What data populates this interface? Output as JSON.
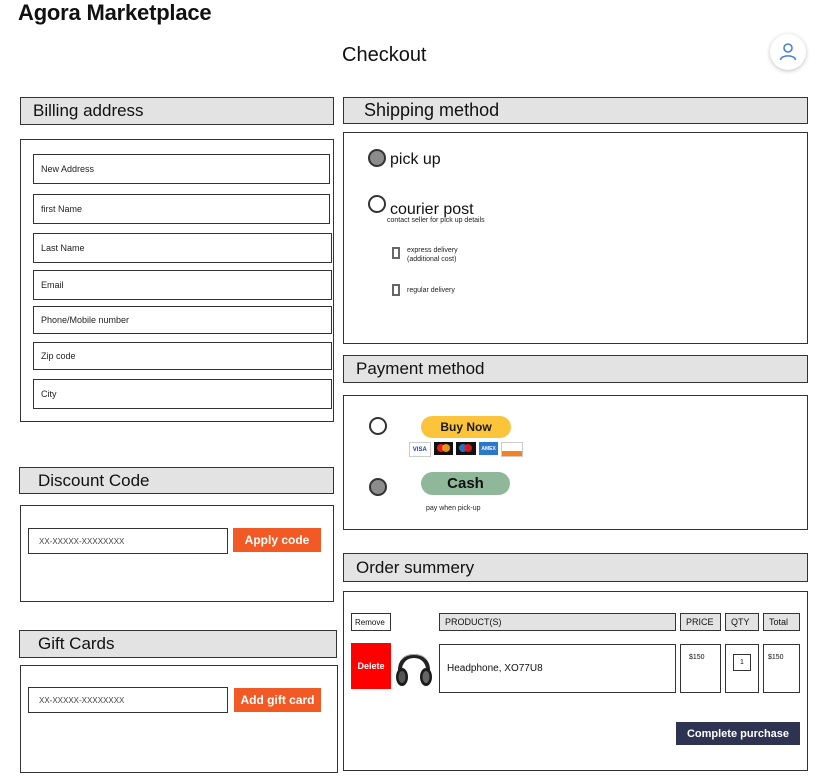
{
  "app": {
    "title": "Agora Marketplace"
  },
  "page": {
    "title": "Checkout"
  },
  "icons": {
    "user": "user-icon",
    "headphones": "headphones-icon"
  },
  "colors": {
    "accent": "#f15a24",
    "header_bg": "#e3e3e3",
    "delete": "#ff0000",
    "complete": "#2d3350",
    "cash": "#8fb89a",
    "buy_now": "#fbc43a"
  },
  "billing": {
    "header": "Billing address",
    "fields": [
      {
        "placeholder": "New Address"
      },
      {
        "placeholder": "first Name"
      },
      {
        "placeholder": "Last Name"
      },
      {
        "placeholder": "Email"
      },
      {
        "placeholder": "Phone/Mobile number"
      },
      {
        "placeholder": "Zip code"
      },
      {
        "placeholder": "City"
      }
    ]
  },
  "discount": {
    "header": "Discount Code",
    "placeholder": "XX-XXXXX-XXXXXXXX",
    "button": "Apply code"
  },
  "gift": {
    "header": "Gift Cards",
    "placeholder": "XX-XXXXX-XXXXXXXX",
    "button": "Add gift card"
  },
  "shipping": {
    "header": "Shipping method",
    "pickup_label": "pick up",
    "courier_label": "courier post",
    "courier_note": "contact seller for pick up details",
    "express_line1": "express delivery",
    "express_line2": "(additional cost)",
    "regular": "regular delivery"
  },
  "payment": {
    "header": "Payment method",
    "buy_now": "Buy Now",
    "cards": [
      "VISA",
      "MC",
      "Maestro",
      "AMEX",
      "DISCOVER"
    ],
    "cash": "Cash",
    "cash_note": "pay when pick-up"
  },
  "order": {
    "header": "Order summery",
    "columns": {
      "remove": "Remove",
      "products": "PRODUCT(S)",
      "price": "PRICE",
      "qty": "QTY",
      "total": "Total"
    },
    "row": {
      "delete": "Delete",
      "product": "Headphone, XO77U8",
      "price": "$150",
      "qty": "1",
      "total": "$150"
    },
    "complete": "Complete purchase"
  }
}
